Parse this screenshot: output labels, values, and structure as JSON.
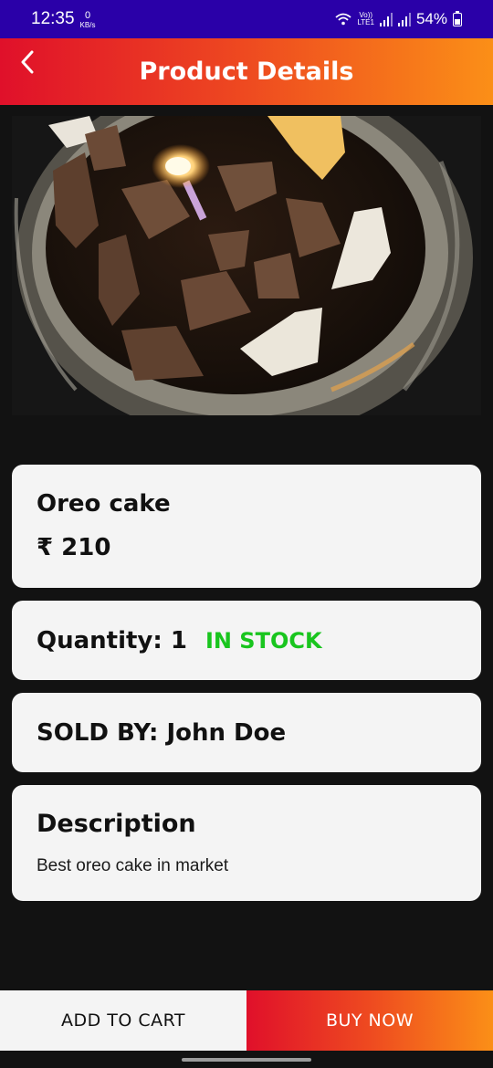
{
  "status_bar": {
    "time": "12:35",
    "data_speed_value": "0",
    "data_speed_unit": "KB/s",
    "volte_top": "Vo))",
    "volte_bottom": "LTE1",
    "battery_percent": "54%",
    "icons": [
      "wifi-icon",
      "signal-icon",
      "signal-icon",
      "battery-icon"
    ]
  },
  "app_bar": {
    "title": "Product Details",
    "back_icon": "chevron-left-icon"
  },
  "product": {
    "image_alt": "cake-photo",
    "name": "Oreo cake",
    "price": "₹ 210",
    "quantity_label": "Quantity: 1",
    "stock_status": "IN STOCK",
    "seller_label": "SOLD BY: John Doe",
    "description_title": "Description",
    "description_text": "Best oreo cake in market"
  },
  "actions": {
    "add_to_cart": "ADD TO CART",
    "buy_now": "BUY NOW"
  },
  "colors": {
    "status_bar": "#2a00a8",
    "gradient_start": "#e0102a",
    "gradient_end": "#fb8f17",
    "background": "#121212",
    "card": "#f4f4f4",
    "in_stock": "#19c51e"
  }
}
